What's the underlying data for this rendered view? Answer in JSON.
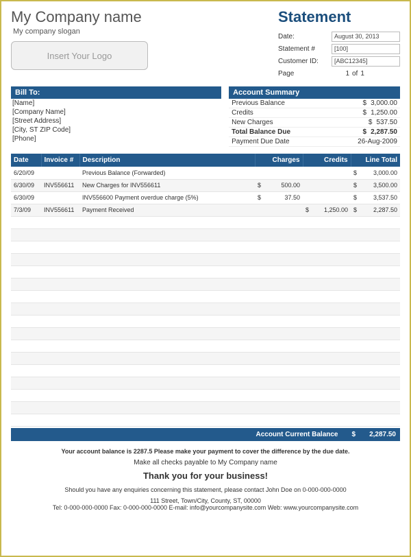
{
  "header": {
    "company_name": "My Company name",
    "slogan": "My company slogan",
    "doc_title": "Statement",
    "logo_placeholder": "Insert Your Logo"
  },
  "meta": {
    "date_label": "Date:",
    "date_value": "August 30, 2013",
    "stmt_label": "Statement #",
    "stmt_value": "[100]",
    "cust_label": "Customer ID:",
    "cust_value": "[ABC12345]",
    "page_label": "Page",
    "page_num": "1",
    "page_of": "of",
    "page_total": "1"
  },
  "billto": {
    "title": "Bill To:",
    "lines": [
      "[Name]",
      "[Company Name]",
      "[Street Address]",
      "[City, ST  ZIP Code]",
      "[Phone]"
    ]
  },
  "summary": {
    "title": "Account Summary",
    "rows": [
      {
        "label": "Previous Balance",
        "cur": "$",
        "val": "3,000.00"
      },
      {
        "label": "Credits",
        "cur": "$",
        "val": "1,250.00"
      },
      {
        "label": "New Charges",
        "cur": "$",
        "val": "537.50"
      },
      {
        "label": "Total Balance Due",
        "cur": "$",
        "val": "2,287.50",
        "bold": true
      },
      {
        "label": "Payment Due Date",
        "cur": "",
        "val": "26-Aug-2009"
      }
    ]
  },
  "columns": {
    "date": "Date",
    "inv": "Invoice #",
    "desc": "Description",
    "chg": "Charges",
    "cre": "Credits",
    "tot": "Line Total"
  },
  "rows": [
    {
      "date": "6/20/09",
      "inv": "",
      "desc": "Previous Balance (Forwarded)",
      "chg_c": "",
      "chg": "",
      "cre_c": "",
      "cre": "",
      "tot_c": "$",
      "tot": "3,000.00"
    },
    {
      "date": "6/30/09",
      "inv": "INV556611",
      "desc": "New Charges for INV556611",
      "chg_c": "$",
      "chg": "500.00",
      "cre_c": "",
      "cre": "",
      "tot_c": "$",
      "tot": "3,500.00"
    },
    {
      "date": "6/30/09",
      "inv": "",
      "desc": "INV556600 Payment overdue charge (5%)",
      "chg_c": "$",
      "chg": "37.50",
      "cre_c": "",
      "cre": "",
      "tot_c": "$",
      "tot": "3,537.50"
    },
    {
      "date": "7/3/09",
      "inv": "INV556611",
      "desc": "Payment Received",
      "chg_c": "",
      "chg": "",
      "cre_c": "$",
      "cre": "1,250.00",
      "tot_c": "$",
      "tot": "2,287.50"
    },
    {
      "date": "",
      "inv": "",
      "desc": "",
      "chg_c": "",
      "chg": "",
      "cre_c": "",
      "cre": "",
      "tot_c": "",
      "tot": ""
    },
    {
      "date": "",
      "inv": "",
      "desc": "",
      "chg_c": "",
      "chg": "",
      "cre_c": "",
      "cre": "",
      "tot_c": "",
      "tot": ""
    },
    {
      "date": "",
      "inv": "",
      "desc": "",
      "chg_c": "",
      "chg": "",
      "cre_c": "",
      "cre": "",
      "tot_c": "",
      "tot": ""
    },
    {
      "date": "",
      "inv": "",
      "desc": "",
      "chg_c": "",
      "chg": "",
      "cre_c": "",
      "cre": "",
      "tot_c": "",
      "tot": ""
    },
    {
      "date": "",
      "inv": "",
      "desc": "",
      "chg_c": "",
      "chg": "",
      "cre_c": "",
      "cre": "",
      "tot_c": "",
      "tot": ""
    },
    {
      "date": "",
      "inv": "",
      "desc": "",
      "chg_c": "",
      "chg": "",
      "cre_c": "",
      "cre": "",
      "tot_c": "",
      "tot": ""
    },
    {
      "date": "",
      "inv": "",
      "desc": "",
      "chg_c": "",
      "chg": "",
      "cre_c": "",
      "cre": "",
      "tot_c": "",
      "tot": ""
    },
    {
      "date": "",
      "inv": "",
      "desc": "",
      "chg_c": "",
      "chg": "",
      "cre_c": "",
      "cre": "",
      "tot_c": "",
      "tot": ""
    },
    {
      "date": "",
      "inv": "",
      "desc": "",
      "chg_c": "",
      "chg": "",
      "cre_c": "",
      "cre": "",
      "tot_c": "",
      "tot": ""
    },
    {
      "date": "",
      "inv": "",
      "desc": "",
      "chg_c": "",
      "chg": "",
      "cre_c": "",
      "cre": "",
      "tot_c": "",
      "tot": ""
    },
    {
      "date": "",
      "inv": "",
      "desc": "",
      "chg_c": "",
      "chg": "",
      "cre_c": "",
      "cre": "",
      "tot_c": "",
      "tot": ""
    },
    {
      "date": "",
      "inv": "",
      "desc": "",
      "chg_c": "",
      "chg": "",
      "cre_c": "",
      "cre": "",
      "tot_c": "",
      "tot": ""
    },
    {
      "date": "",
      "inv": "",
      "desc": "",
      "chg_c": "",
      "chg": "",
      "cre_c": "",
      "cre": "",
      "tot_c": "",
      "tot": ""
    },
    {
      "date": "",
      "inv": "",
      "desc": "",
      "chg_c": "",
      "chg": "",
      "cre_c": "",
      "cre": "",
      "tot_c": "",
      "tot": ""
    },
    {
      "date": "",
      "inv": "",
      "desc": "",
      "chg_c": "",
      "chg": "",
      "cre_c": "",
      "cre": "",
      "tot_c": "",
      "tot": ""
    },
    {
      "date": "",
      "inv": "",
      "desc": "",
      "chg_c": "",
      "chg": "",
      "cre_c": "",
      "cre": "",
      "tot_c": "",
      "tot": ""
    },
    {
      "date": "",
      "inv": "",
      "desc": "",
      "chg_c": "",
      "chg": "",
      "cre_c": "",
      "cre": "",
      "tot_c": "",
      "tot": ""
    }
  ],
  "total_bar": {
    "label": "Account Current Balance",
    "cur": "$",
    "val": "2,287.50"
  },
  "footer": {
    "balance_msg": "Your account balance is 2287.5 Please make your payment to cover the difference by the due date.",
    "payable": "Make all checks payable to My Company name",
    "thanks": "Thank you for your business!",
    "enquiry": "Should you have any enquiries concerning this statement, please contact John Doe on 0-000-000-0000",
    "address": "111 Street, Town/City, County, ST, 00000",
    "contact": "Tel: 0-000-000-0000 Fax: 0-000-000-0000 E-mail: info@yourcompanysite.com Web: www.yourcompanysite.com"
  }
}
